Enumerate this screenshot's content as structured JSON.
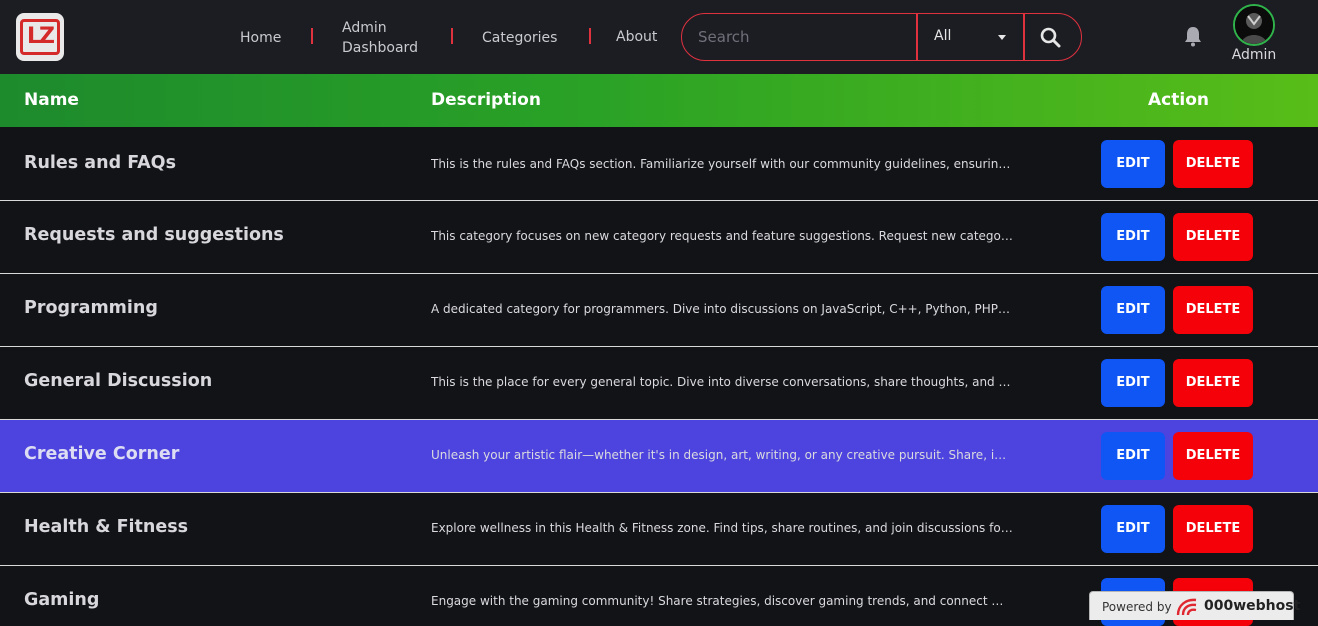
{
  "nav": {
    "logo_text": "LZ",
    "links": [
      "Home",
      "Admin Dashboard",
      "Categories",
      "About"
    ],
    "search_placeholder": "Search",
    "search_filter": "All",
    "user_name": "Admin"
  },
  "table": {
    "headers": [
      "Name",
      "Description",
      "Action"
    ],
    "rows": [
      {
        "name": "Rules and FAQs",
        "description": "This is the rules and FAQs section. Familiarize yourself with our community guidelines, ensuring a positive experience for all members."
      },
      {
        "name": "Requests and suggestions",
        "description": "This category focuses on new category requests and feature suggestions. Request new categories or share your ideas."
      },
      {
        "name": "Programming",
        "description": "A dedicated category for programmers. Dive into discussions on JavaScript, C++, Python, PHP, Java and more."
      },
      {
        "name": "General Discussion",
        "description": "This is the place for every general topic. Dive into diverse conversations, share thoughts, and connect with others."
      },
      {
        "name": "Creative Corner",
        "description": "Unleash your artistic flair—whether it's in design, art, writing, or any creative pursuit. Share, inspire and grow."
      },
      {
        "name": "Health & Fitness",
        "description": "Explore wellness in this Health & Fitness zone. Find tips, share routines, and join discussions for a healthier life."
      },
      {
        "name": "Gaming",
        "description": "Engage with the gaming community! Share strategies, discover gaming trends, and connect with fellow gamers."
      }
    ],
    "edit_label": "EDIT",
    "delete_label": "DELETE"
  },
  "footer_badge": {
    "powered_text": "Powered by",
    "brand": "000webhost"
  },
  "colors": {
    "accent_red": "#e0313f",
    "header_green": "#2aa226",
    "highlight_row": "#4d43de",
    "edit_blue": "#0f56f5",
    "delete_red": "#f4010a"
  }
}
